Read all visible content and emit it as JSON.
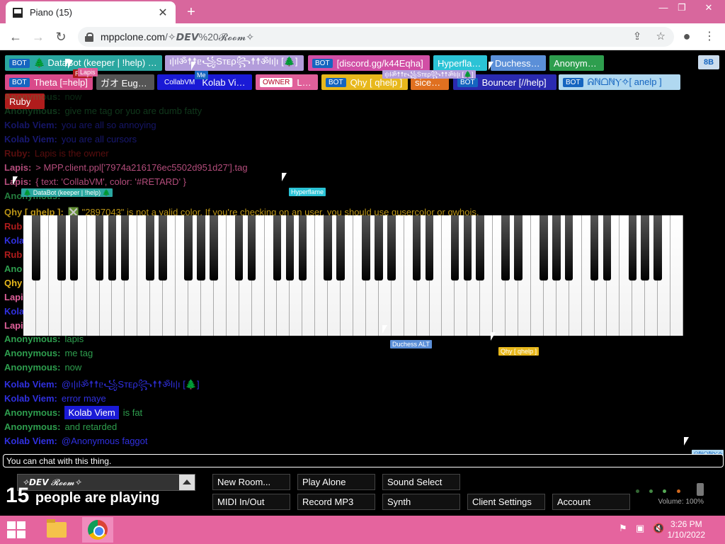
{
  "browser": {
    "tab_title": "Piano (15)",
    "tab_close": "✕",
    "new_tab": "+",
    "win_min": "—",
    "win_max": "❐",
    "win_close": "✕",
    "back": "←",
    "forward": "→",
    "reload": "↻",
    "url_domain": "mppclone.com",
    "url_path": "/✧𝘿𝙀𝙑%20𝓡𝓸𝓸𝓶✧",
    "share": "⇪",
    "star": "☆",
    "profile": "●",
    "menu": "⋮"
  },
  "users": [
    {
      "badge": "BOT",
      "name": "🌲 DataBot (keeper | !help) 🌲",
      "bg": "#2aa7a0",
      "badge_bg": "#1565c0"
    },
    {
      "badge": "",
      "name": "ı|ılॐ☨☨ᥱ꧁Sᴛᴇρ꧂☨☨ॐlı|ı [🌲]",
      "bg": "#b39ddb",
      "badge_bg": ""
    },
    {
      "badge": "BOT",
      "name": "[discord.gg/k44Eqha]",
      "bg": "#d14fa5",
      "badge_bg": "#1565c0"
    },
    {
      "badge": "",
      "name": "Hyperflame",
      "bg": "#2bc3d6",
      "badge_bg": ""
    },
    {
      "badge": "",
      "name": "Duchess ALT",
      "bg": "#5b8fd8",
      "badge_bg": ""
    },
    {
      "badge": "",
      "name": "Anonymous",
      "bg": "#2e9e4e",
      "badge_bg": ""
    },
    {
      "badge": "BOT",
      "name": "Theta [=help]",
      "bg": "#d94a8a",
      "badge_bg": "#1565c0"
    },
    {
      "badge": "",
      "name": "ガオ Eugyne",
      "bg": "#555555",
      "badge_bg": ""
    },
    {
      "badge": "CollabVM",
      "name": "Kolab Viem",
      "bg": "#1a1ad6",
      "badge_bg": "#1a1ad6"
    },
    {
      "badge": "OWNER",
      "name": "Lapis",
      "bg": "#e0609a",
      "badge_bg": "#b00020"
    },
    {
      "badge": "BOT",
      "name": "Qhy [ qhelp ]",
      "bg": "#e8b81c",
      "badge_bg": "#1565c0"
    },
    {
      "badge": "",
      "name": "siceon7",
      "bg": "#e07020",
      "badge_bg": ""
    },
    {
      "badge": "BOT",
      "name": "Bouncer [//help]",
      "bg": "#2a2ab0",
      "badge_bg": "#1565c0"
    },
    {
      "badge": "BOT",
      "name": "ᕱℕᗝℕⲨ✧[ anelp ]",
      "bg": "#b0d8f0",
      "badge_bg": "#1565c0"
    },
    {
      "badge": "",
      "name": "Ruby",
      "bg": "#b01c1c",
      "badge_bg": ""
    }
  ],
  "top_right_label": "8B",
  "chat": [
    {
      "name": "Anonymous:",
      "msg": "now",
      "color": "#2e9e4e",
      "alpha": 0.25
    },
    {
      "name": "Anonymous:",
      "msg": "give me tag or yuo are dumb fatty",
      "color": "#2e9e4e",
      "alpha": 0.35
    },
    {
      "name": "Kolab Viem:",
      "msg": "you are all so annoying",
      "color": "#3030e0",
      "alpha": 0.45
    },
    {
      "name": "Kolab Viem:",
      "msg": "you are all cursors",
      "color": "#3030e0",
      "alpha": 0.5
    },
    {
      "name": "Ruby:",
      "msg": "Lapis is the owner",
      "color": "#b01c1c",
      "alpha": 0.5
    },
    {
      "name": "Lapis:",
      "msg": "> MPP.client.ppl['7974a216176ec5502d951d27'].tag",
      "color": "#e0609a",
      "alpha": 0.8
    },
    {
      "name": "Lapis:",
      "msg": "{ text: 'CollabVM', color: '#RETARD' }",
      "color": "#e0609a",
      "alpha": 0.8
    },
    {
      "name": "Anonymous:",
      "msg": "",
      "color": "#2e9e4e",
      "alpha": 0.8
    },
    {
      "name": "Qhy [ qhelp ]:",
      "msg": "❎ \"2897043\" is not a valid color. If you're checking on an user, you should use qusercolor or qwhois.",
      "color": "#e8b81c",
      "alpha": 0.8
    },
    {
      "name": "Anonymous:",
      "msg": "lapis",
      "color": "#2e9e4e",
      "alpha": 1
    },
    {
      "name": "Anonymous:",
      "msg": "me tag",
      "color": "#2e9e4e",
      "alpha": 1
    },
    {
      "name": "Anonymous:",
      "msg": "now",
      "color": "#2e9e4e",
      "alpha": 1
    },
    {
      "name": "Kolab Viem:",
      "msg": "@ı|ılॐ☨☨ᥱ꧁Sᴛᴇρ꧂☨☨ॐlı|ı [🌲]",
      "color": "#3030e0",
      "alpha": 1
    },
    {
      "name": "Kolab Viem:",
      "msg": "error maye",
      "color": "#3030e0",
      "alpha": 1
    },
    {
      "name": "Anonymous:",
      "msg": "is fat",
      "color": "#2e9e4e",
      "alpha": 1,
      "mention": "Kolab Viem"
    },
    {
      "name": "Anonymous:",
      "msg": "and retarded",
      "color": "#2e9e4e",
      "alpha": 1
    },
    {
      "name": "Kolab Viem:",
      "msg": "@Anonymous faggot",
      "color": "#3030e0",
      "alpha": 1
    }
  ],
  "hidden_chat_initials": [
    {
      "text": "Rub",
      "color": "#b01c1c"
    },
    {
      "text": "Kolab",
      "color": "#3030e0"
    },
    {
      "text": "Rub",
      "color": "#b01c1c"
    },
    {
      "text": "Ano",
      "color": "#2e9e4e"
    },
    {
      "text": "Qhy",
      "color": "#e8b81c"
    },
    {
      "text": "Lapi",
      "color": "#e0609a"
    },
    {
      "text": "Kola",
      "color": "#3030e0"
    },
    {
      "text": "Lapi",
      "color": "#e0609a"
    }
  ],
  "cursors": [
    {
      "label": "Ruby",
      "bg": "#b01c1c"
    },
    {
      "label": "Lapis",
      "bg": "#e0609a"
    },
    {
      "label": "Me",
      "bg": "#1565c0"
    },
    {
      "label": "🌲 DataBot (keeper | !help) 🌲",
      "bg": "#2aa7a0"
    },
    {
      "label": "Hyperflame",
      "bg": "#2bc3d6"
    },
    {
      "label": "Duchess ALT",
      "bg": "#5b8fd8"
    },
    {
      "label": "Qhy [ qhelp ]",
      "bg": "#e8b81c"
    },
    {
      "label": "ı|ılॐ☨☨ᥱ꧁Sᴛᴇρ꧂☨☨ॐlı|ı [🌲]",
      "bg": "#b39ddb"
    },
    {
      "label": "Anonymous",
      "bg": "#2e9e4e"
    },
    {
      "label": "[discord.gg/k44Eqha]",
      "bg": "#d14fa5"
    },
    {
      "label": "ᕱℕᗝℕⲨ✧",
      "bg": "#b0d8f0"
    }
  ],
  "chat_input_placeholder": "You can chat with this thing.",
  "room_name": "✧𝘿𝙀𝙑 𝓡𝓸𝓸𝓶✧",
  "count_num": "15",
  "count_text": "people are playing",
  "buttons": {
    "new_room": "New Room...",
    "play_alone": "Play Alone",
    "sound_select": "Sound Select",
    "midi": "MIDI In/Out",
    "record": "Record MP3",
    "synth": "Synth",
    "client_settings": "Client Settings",
    "account": "Account"
  },
  "volume_label": "Volume: 100%",
  "taskbar": {
    "time": "3:26 PM",
    "date": "1/10/2022",
    "flag": "⚑",
    "network": "▣",
    "speaker": "🔇"
  }
}
